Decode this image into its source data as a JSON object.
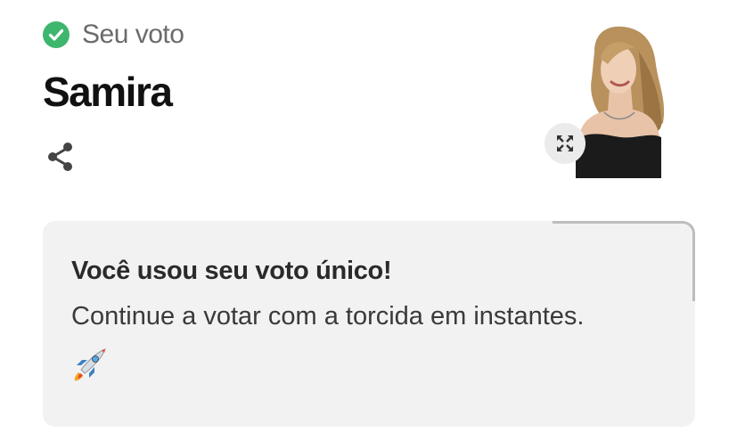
{
  "vote": {
    "label": "Seu voto",
    "status_icon": "check-circle-icon",
    "status_color": "#3fb66e"
  },
  "candidate": {
    "name": "Samira",
    "photo": "candidate-photo"
  },
  "actions": {
    "share_icon": "share-icon",
    "expand_icon": "expand-icon"
  },
  "notice": {
    "title": "Você usou seu voto único!",
    "message": "Continue a votar com a torcida em instantes.",
    "emoji_icon": "rocket-icon"
  }
}
